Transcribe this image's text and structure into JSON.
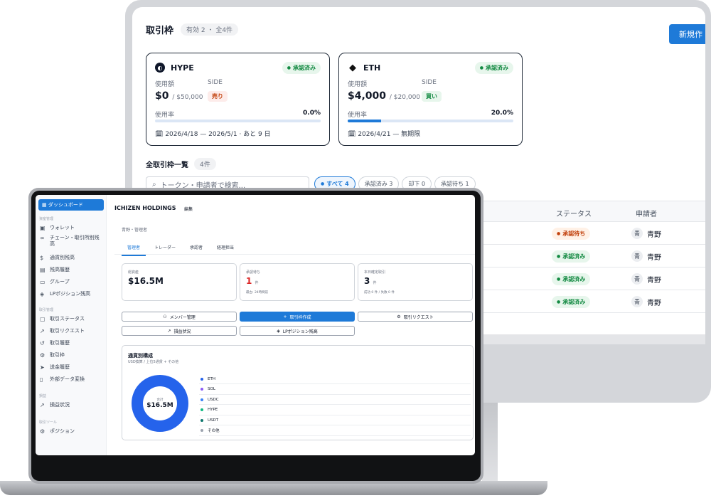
{
  "desktop": {
    "title": "取引枠",
    "count_badge": "有効 2 ・ 全4件",
    "new_button": "新規作",
    "cards": [
      {
        "token": "HYPE",
        "status": "承認済み",
        "used_label": "使用額",
        "side_label": "SIDE",
        "used": "$0",
        "limit": "/ $50,000",
        "side": "売り",
        "rate_label": "使用率",
        "rate": "0.0%",
        "rate_value": 0.0,
        "period": "2026/4/18 — 2026/5/1 · あと 9 日"
      },
      {
        "token": "ETH",
        "status": "承認済み",
        "used_label": "使用額",
        "side_label": "SIDE",
        "used": "$4,000",
        "limit": "/ $20,000",
        "side": "買い",
        "rate_label": "使用率",
        "rate": "20.0%",
        "rate_value": 0.2,
        "period": "2026/4/21 — 無期限"
      }
    ],
    "list_title": "全取引枠一覧",
    "list_count": "4件",
    "search_placeholder": "トークン・申請者で検索...",
    "filters": [
      "すべて 4",
      "承認済み 3",
      "却下 0",
      "承認待ち 1"
    ],
    "table": {
      "headers": {
        "status": "ステータス",
        "applicant": "申請者"
      },
      "rows": [
        {
          "frag": "",
          "status": "承認待ち",
          "avatar": "青",
          "applicant": "青野"
        },
        {
          "frag": "/1",
          "status": "承認済み",
          "avatar": "青",
          "applicant": "青野"
        },
        {
          "frag": "",
          "status": "承認済み",
          "avatar": "青",
          "applicant": "青野"
        },
        {
          "frag": "",
          "status": "承認済み",
          "avatar": "青",
          "applicant": "青野"
        }
      ]
    }
  },
  "laptop": {
    "sidebar": {
      "active": "ダッシュボード",
      "sections": [
        "資産管理",
        "取引管理",
        "損益",
        "取引ツール"
      ],
      "items": {
        "wallet": "ウォレット",
        "chain": "チェーン・取引所別残高",
        "currency": "通貨別残高",
        "balance_history": "残高履歴",
        "group": "グループ",
        "lp": "LPポジション残高",
        "trade_status": "取引ステータス",
        "trade_request": "取引リクエスト",
        "trade_history": "取引履歴",
        "trade_limit": "取引枠",
        "transfer": "送金履歴",
        "external": "外部データ変換",
        "pnl": "損益状況",
        "position": "ポジション"
      }
    },
    "company": "ICHIZEN HOLDINGS",
    "edit": "編集",
    "breadcrumb": "青野・管理者",
    "tabs": [
      "管理者",
      "トレーダー",
      "承認者",
      "経理担当"
    ],
    "stats": [
      {
        "label": "総資産",
        "value": "$16.5M",
        "unit": "",
        "sub": ""
      },
      {
        "label": "承認待ち",
        "value": "1",
        "unit": "件",
        "sub": "最古: 24時間前"
      },
      {
        "label": "本日確定取引",
        "value": "3",
        "unit": "件",
        "sub": "成功 0 件 / 失敗 0 件"
      }
    ],
    "actions": [
      "メンバー管理",
      "取引枠作成",
      "取引リクエスト",
      "損益状況",
      "LPポジション残高"
    ],
    "composition": {
      "title": "通貨別構成",
      "subtitle": "USD換算 / 上位5通貨 + その他",
      "total_label": "合計",
      "total": "$16.5M",
      "legend": [
        {
          "name": "ETH",
          "color": "#2563eb"
        },
        {
          "name": "SOL",
          "color": "#8b5cf6"
        },
        {
          "name": "USDC",
          "color": "#3b82f6"
        },
        {
          "name": "HYPE",
          "color": "#10b981"
        },
        {
          "name": "USDT",
          "color": "#0f766e"
        },
        {
          "name": "その他",
          "color": "#9ca3af"
        }
      ]
    }
  }
}
